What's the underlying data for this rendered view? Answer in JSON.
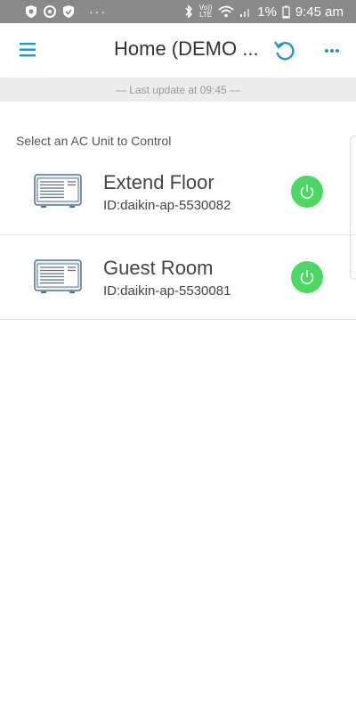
{
  "status_bar": {
    "battery_percent": "1%",
    "time": "9:45 am",
    "volte_label": "Vo)) LTE",
    "dots": "···",
    "icons": [
      "shield-icon",
      "data-saver-icon",
      "shield-icon",
      "bluetooth-icon",
      "volte-icon",
      "wifi-icon",
      "signal-icon",
      "battery-icon"
    ]
  },
  "header": {
    "title": "Home (DEMO ...",
    "icons": [
      "menu-icon",
      "refresh-icon",
      "more-icon"
    ],
    "accent_color": "#1a9bbd"
  },
  "banner": {
    "last_update": "— Last update at 09:45 —"
  },
  "main": {
    "section_label": "Select an AC Unit to Control",
    "units": [
      {
        "name": "Extend Floor",
        "id": "ID:daikin-ap-5530082",
        "power_icon": "power-icon",
        "power_color": "#4cd664"
      },
      {
        "name": "Guest Room",
        "id": "ID:daikin-ap-5530081",
        "power_icon": "power-icon",
        "power_color": "#4cd664"
      }
    ]
  }
}
